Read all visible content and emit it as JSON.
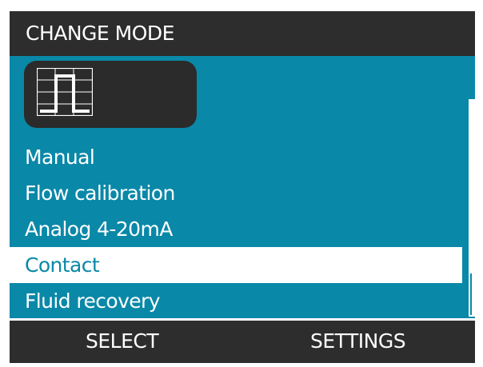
{
  "header": {
    "title": "CHANGE MODE"
  },
  "current_mode_icon": {
    "icon": "pulse-waveform-icon"
  },
  "mode_list": {
    "items": [
      {
        "label": "Manual"
      },
      {
        "label": "Flow calibration"
      },
      {
        "label": "Analog 4-20mA"
      },
      {
        "label": "Contact"
      },
      {
        "label": "Fluid recovery"
      }
    ],
    "selected_index": 3
  },
  "softkeys": {
    "left_label": "SELECT",
    "right_label": "SETTINGS"
  },
  "colors": {
    "background_dark": "#2d2d2d",
    "accent_teal": "#0a88a8",
    "highlight": "#ffffff",
    "text": "#ffffff"
  }
}
